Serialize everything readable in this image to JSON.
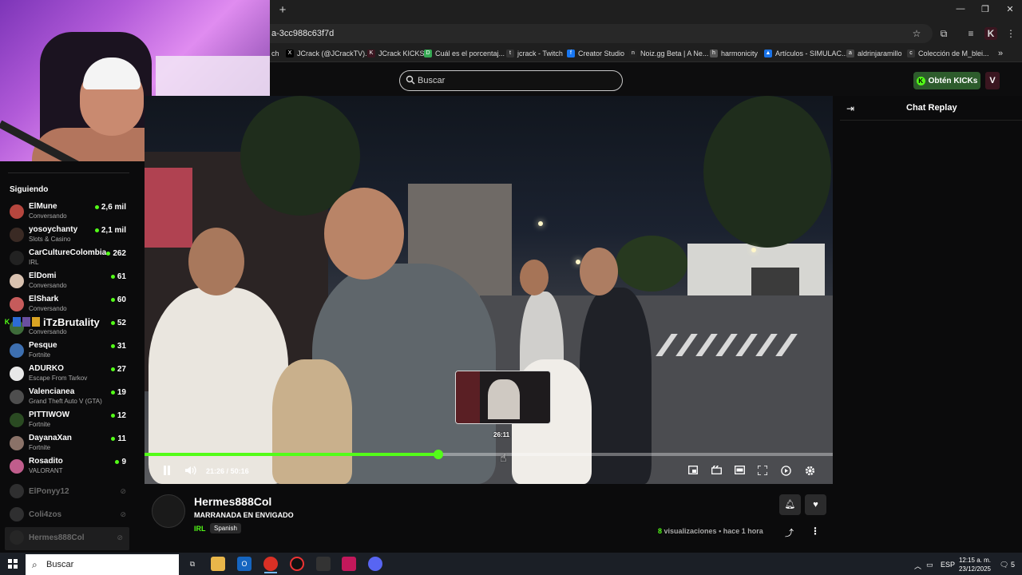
{
  "browser": {
    "url_fragment": "a-3cc988c63f7d",
    "new_tab": "+",
    "window_controls": [
      "—",
      "❐",
      "✕"
    ],
    "bookmarks": [
      {
        "label": "ch",
        "icon_color": "#444"
      },
      {
        "label": "JCrack (@JCrackTV)...",
        "icon": "X",
        "icon_color": "#000000"
      },
      {
        "label": "JCrack KICKS",
        "icon": "K",
        "icon_color": "#3a1620"
      },
      {
        "label": "Cuál es el porcentaj...",
        "icon": "D",
        "icon_color": "#35a853"
      },
      {
        "label": "jcrack - Twitch",
        "icon": "t",
        "icon_color": "#333"
      },
      {
        "label": "Creator Studio",
        "icon": "f",
        "icon_color": "#1877f2"
      },
      {
        "label": "Noiz.gg Beta | A Ne...",
        "icon": "n",
        "icon_color": "#222"
      },
      {
        "label": "harmonicity",
        "icon": "h",
        "icon_color": "#555"
      },
      {
        "label": "Artículos - SIMULAC...",
        "icon": "▲",
        "icon_color": "#1a73e8"
      },
      {
        "label": "aldrinjaramillo",
        "icon": "a",
        "icon_color": "#444"
      },
      {
        "label": "Colección de M_blei...",
        "icon": "c",
        "icon_color": "#333"
      }
    ]
  },
  "header": {
    "search_placeholder": "Buscar",
    "kicks_button": "Obtén KICKs",
    "avatar_initial": "V"
  },
  "sidebar": {
    "title": "Siguiendo",
    "live": [
      {
        "name": "ElMune",
        "category": "Conversando",
        "viewers": "2,6 mil",
        "color": "#b5463e"
      },
      {
        "name": "yosoychanty",
        "category": "Slots & Casino",
        "viewers": "2,1 mil",
        "color": "#3a2a24"
      },
      {
        "name": "CarCultureColombia",
        "category": "IRL",
        "viewers": "262",
        "color": "#222"
      },
      {
        "name": "ElDomi",
        "category": "Conversando",
        "viewers": "61",
        "color": "#d9c2b0"
      },
      {
        "name": "ElShark",
        "category": "Conversando",
        "viewers": "60",
        "color": "#c65b5b"
      },
      {
        "name": "",
        "category": "Conversando",
        "viewers": "52",
        "color": "#3e6b3a"
      },
      {
        "name": "Pesque",
        "category": "Fortnite",
        "viewers": "31",
        "color": "#3d6fb0"
      },
      {
        "name": "ADURKO",
        "category": "Escape From Tarkov",
        "viewers": "27",
        "color": "#e8e8e8"
      },
      {
        "name": "Valencianea",
        "category": "Grand Theft Auto V (GTA)",
        "viewers": "19",
        "color": "#4e4e4e"
      },
      {
        "name": "PITTIWOW",
        "category": "Fortnite",
        "viewers": "12",
        "color": "#2a4a22"
      },
      {
        "name": "DayanaXan",
        "category": "Fortnite",
        "viewers": "11",
        "color": "#8a7268"
      },
      {
        "name": "Rosadito",
        "category": "VALORANT",
        "viewers": "9",
        "color": "#c05d8c"
      }
    ],
    "offline": [
      {
        "name": "ElPonyy12",
        "color": "#666"
      },
      {
        "name": "Coli4zos",
        "color": "#666"
      },
      {
        "name": "Hermes888Col",
        "color": "#333"
      }
    ],
    "overlay_text": "iTzBrutality",
    "overlay_prefix": "K"
  },
  "player": {
    "current_time": "21:26",
    "total_time": "50:16",
    "time_separator": "/",
    "preview_time": "26:11",
    "progress_fraction": 0.427,
    "accent": "#53fc18"
  },
  "chat": {
    "title": "Chat Replay"
  },
  "stream": {
    "streamer": "Hermes888Col",
    "title": "MARRANADA EN ENVIGADO",
    "category": "IRL",
    "language": "Spanish",
    "views_count": "8",
    "views_label": "visualizaciones",
    "separator": "•",
    "time_ago": "hace 1 hora"
  },
  "taskbar": {
    "search_placeholder": "Buscar",
    "language": "ESP",
    "time": "12:15 a. m.",
    "date": "23/12/2025",
    "notifications": "5"
  }
}
